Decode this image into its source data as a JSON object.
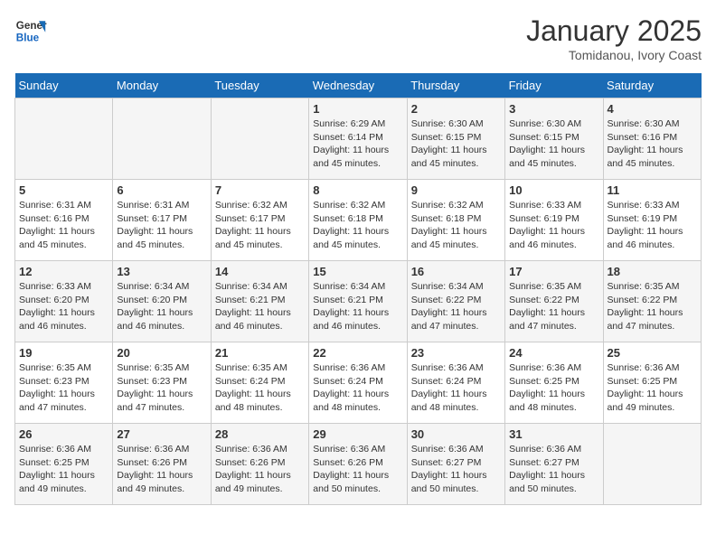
{
  "header": {
    "logo_line1": "General",
    "logo_line2": "Blue",
    "month": "January 2025",
    "location": "Tomidanou, Ivory Coast"
  },
  "weekdays": [
    "Sunday",
    "Monday",
    "Tuesday",
    "Wednesday",
    "Thursday",
    "Friday",
    "Saturday"
  ],
  "weeks": [
    [
      {
        "day": "",
        "info": ""
      },
      {
        "day": "",
        "info": ""
      },
      {
        "day": "",
        "info": ""
      },
      {
        "day": "1",
        "info": "Sunrise: 6:29 AM\nSunset: 6:14 PM\nDaylight: 11 hours and 45 minutes."
      },
      {
        "day": "2",
        "info": "Sunrise: 6:30 AM\nSunset: 6:15 PM\nDaylight: 11 hours and 45 minutes."
      },
      {
        "day": "3",
        "info": "Sunrise: 6:30 AM\nSunset: 6:15 PM\nDaylight: 11 hours and 45 minutes."
      },
      {
        "day": "4",
        "info": "Sunrise: 6:30 AM\nSunset: 6:16 PM\nDaylight: 11 hours and 45 minutes."
      }
    ],
    [
      {
        "day": "5",
        "info": "Sunrise: 6:31 AM\nSunset: 6:16 PM\nDaylight: 11 hours and 45 minutes."
      },
      {
        "day": "6",
        "info": "Sunrise: 6:31 AM\nSunset: 6:17 PM\nDaylight: 11 hours and 45 minutes."
      },
      {
        "day": "7",
        "info": "Sunrise: 6:32 AM\nSunset: 6:17 PM\nDaylight: 11 hours and 45 minutes."
      },
      {
        "day": "8",
        "info": "Sunrise: 6:32 AM\nSunset: 6:18 PM\nDaylight: 11 hours and 45 minutes."
      },
      {
        "day": "9",
        "info": "Sunrise: 6:32 AM\nSunset: 6:18 PM\nDaylight: 11 hours and 45 minutes."
      },
      {
        "day": "10",
        "info": "Sunrise: 6:33 AM\nSunset: 6:19 PM\nDaylight: 11 hours and 46 minutes."
      },
      {
        "day": "11",
        "info": "Sunrise: 6:33 AM\nSunset: 6:19 PM\nDaylight: 11 hours and 46 minutes."
      }
    ],
    [
      {
        "day": "12",
        "info": "Sunrise: 6:33 AM\nSunset: 6:20 PM\nDaylight: 11 hours and 46 minutes."
      },
      {
        "day": "13",
        "info": "Sunrise: 6:34 AM\nSunset: 6:20 PM\nDaylight: 11 hours and 46 minutes."
      },
      {
        "day": "14",
        "info": "Sunrise: 6:34 AM\nSunset: 6:21 PM\nDaylight: 11 hours and 46 minutes."
      },
      {
        "day": "15",
        "info": "Sunrise: 6:34 AM\nSunset: 6:21 PM\nDaylight: 11 hours and 46 minutes."
      },
      {
        "day": "16",
        "info": "Sunrise: 6:34 AM\nSunset: 6:22 PM\nDaylight: 11 hours and 47 minutes."
      },
      {
        "day": "17",
        "info": "Sunrise: 6:35 AM\nSunset: 6:22 PM\nDaylight: 11 hours and 47 minutes."
      },
      {
        "day": "18",
        "info": "Sunrise: 6:35 AM\nSunset: 6:22 PM\nDaylight: 11 hours and 47 minutes."
      }
    ],
    [
      {
        "day": "19",
        "info": "Sunrise: 6:35 AM\nSunset: 6:23 PM\nDaylight: 11 hours and 47 minutes."
      },
      {
        "day": "20",
        "info": "Sunrise: 6:35 AM\nSunset: 6:23 PM\nDaylight: 11 hours and 47 minutes."
      },
      {
        "day": "21",
        "info": "Sunrise: 6:35 AM\nSunset: 6:24 PM\nDaylight: 11 hours and 48 minutes."
      },
      {
        "day": "22",
        "info": "Sunrise: 6:36 AM\nSunset: 6:24 PM\nDaylight: 11 hours and 48 minutes."
      },
      {
        "day": "23",
        "info": "Sunrise: 6:36 AM\nSunset: 6:24 PM\nDaylight: 11 hours and 48 minutes."
      },
      {
        "day": "24",
        "info": "Sunrise: 6:36 AM\nSunset: 6:25 PM\nDaylight: 11 hours and 48 minutes."
      },
      {
        "day": "25",
        "info": "Sunrise: 6:36 AM\nSunset: 6:25 PM\nDaylight: 11 hours and 49 minutes."
      }
    ],
    [
      {
        "day": "26",
        "info": "Sunrise: 6:36 AM\nSunset: 6:25 PM\nDaylight: 11 hours and 49 minutes."
      },
      {
        "day": "27",
        "info": "Sunrise: 6:36 AM\nSunset: 6:26 PM\nDaylight: 11 hours and 49 minutes."
      },
      {
        "day": "28",
        "info": "Sunrise: 6:36 AM\nSunset: 6:26 PM\nDaylight: 11 hours and 49 minutes."
      },
      {
        "day": "29",
        "info": "Sunrise: 6:36 AM\nSunset: 6:26 PM\nDaylight: 11 hours and 50 minutes."
      },
      {
        "day": "30",
        "info": "Sunrise: 6:36 AM\nSunset: 6:27 PM\nDaylight: 11 hours and 50 minutes."
      },
      {
        "day": "31",
        "info": "Sunrise: 6:36 AM\nSunset: 6:27 PM\nDaylight: 11 hours and 50 minutes."
      },
      {
        "day": "",
        "info": ""
      }
    ]
  ]
}
